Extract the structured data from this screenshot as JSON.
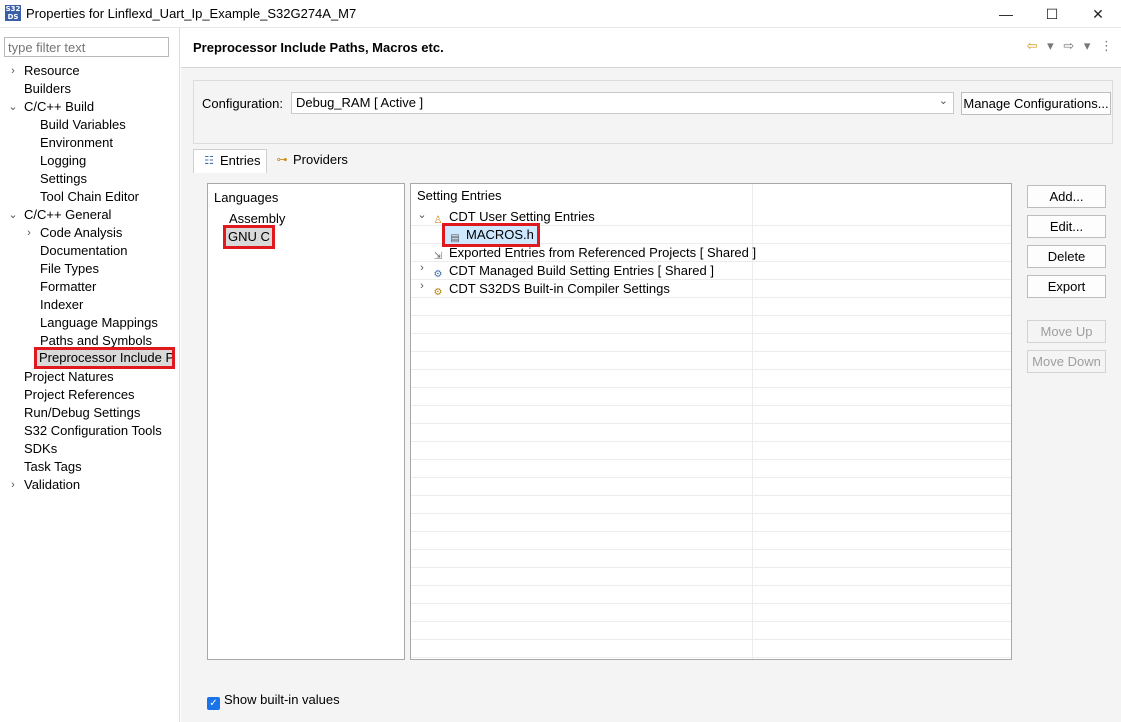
{
  "window": {
    "title": "Properties for Linflexd_Uart_Ip_Example_S32G274A_M7",
    "icon_text": "S32 DS",
    "minimize": "—",
    "maximize": "☐",
    "close": "✕"
  },
  "filter": {
    "placeholder": "type filter text"
  },
  "nav": {
    "items": [
      {
        "label": "Resource",
        "arrow": "›"
      },
      {
        "label": "Builders"
      },
      {
        "label": "C/C++ Build",
        "arrow": "⌄"
      },
      {
        "label": "Build Variables"
      },
      {
        "label": "Environment"
      },
      {
        "label": "Logging"
      },
      {
        "label": "Settings"
      },
      {
        "label": "Tool Chain Editor"
      },
      {
        "label": "C/C++ General",
        "arrow": "⌄"
      },
      {
        "label": "Code Analysis",
        "arrow": "›"
      },
      {
        "label": "Documentation"
      },
      {
        "label": "File Types"
      },
      {
        "label": "Formatter"
      },
      {
        "label": "Indexer"
      },
      {
        "label": "Language Mappings"
      },
      {
        "label": "Paths and Symbols"
      },
      {
        "label": "Preprocessor Include Pa"
      },
      {
        "label": "Project Natures"
      },
      {
        "label": "Project References"
      },
      {
        "label": "Run/Debug Settings"
      },
      {
        "label": "S32 Configuration Tools"
      },
      {
        "label": "SDKs"
      },
      {
        "label": "Task Tags"
      },
      {
        "label": "Validation",
        "arrow": "›"
      }
    ]
  },
  "page": {
    "title": "Preprocessor Include Paths, Macros etc.",
    "back_icon": "⇦",
    "forward_icon": "⇨",
    "dropdown_icon": "▾",
    "menu_icon": "⋮"
  },
  "configuration": {
    "label": "Configuration:",
    "value": "Debug_RAM  [ Active ]",
    "chevron": "⌄",
    "manage_button": "Manage Configurations..."
  },
  "tabs": [
    {
      "label": "Entries",
      "icon": "entries-icon",
      "glyph": "☷"
    },
    {
      "label": "Providers",
      "icon": "providers-icon",
      "glyph": "⊶"
    }
  ],
  "languages": {
    "header": "Languages",
    "items": [
      "Assembly",
      "GNU C"
    ]
  },
  "entries": {
    "header": "Setting Entries",
    "rows": [
      {
        "label": "CDT User Setting Entries",
        "expander": "⌄",
        "glyph": "♙"
      },
      {
        "label": "MACROS.h",
        "glyph": "▤"
      },
      {
        "label": "Exported Entries from Referenced Projects   [ Shared ]",
        "glyph": "⇲"
      },
      {
        "label": "CDT Managed Build Setting Entries   [ Shared ]",
        "expander": "›",
        "glyph": "⚙"
      },
      {
        "label": "CDT S32DS Built-in Compiler Settings",
        "expander": "›",
        "glyph": "⚙"
      }
    ]
  },
  "buttons": {
    "add": "Add...",
    "edit": "Edit...",
    "delete": "Delete",
    "export": "Export",
    "move_up": "Move Up",
    "move_down": "Move Down"
  },
  "show_builtin": {
    "label": "Show built-in values",
    "checked": true,
    "check_glyph": "✓"
  }
}
